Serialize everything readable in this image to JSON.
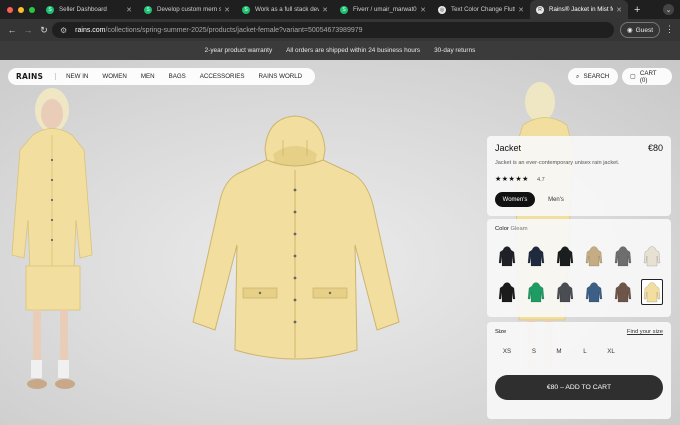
{
  "browser": {
    "tabs": [
      {
        "title": "Seller Dashboard",
        "color": "#1dbf73",
        "glyph": "S"
      },
      {
        "title": "Develop custom mern stack",
        "color": "#1dbf73",
        "glyph": "S"
      },
      {
        "title": "Work as a full stack developer",
        "color": "#1dbf73",
        "glyph": "S"
      },
      {
        "title": "Fiverr / umair_marwat0",
        "color": "#1dbf73",
        "glyph": "S"
      },
      {
        "title": "Text Color Change Flutter",
        "color": "#e8e8e8",
        "glyph": "◎"
      },
      {
        "title": "Rains® Jacket in Mist for Women",
        "color": "#e8e8e8",
        "glyph": "R"
      }
    ],
    "new_tab": "+",
    "url_host": "rains.com",
    "url_path": "/collections/spring-summer-2025/products/jacket-female?variant=50054673989979",
    "profile_label": "Guest",
    "traffic_colors": [
      "#ff5f57",
      "#febc2e",
      "#28c840"
    ]
  },
  "announcement": {
    "items": [
      "2-year product warranty",
      "All orders are shipped within 24 business hours",
      "30-day returns"
    ]
  },
  "nav": {
    "logo": "RAINS",
    "links": [
      "NEW IN",
      "WOMEN",
      "MEN",
      "BAGS",
      "ACCESSORIES",
      "RAINS WORLD"
    ],
    "search_label": "SEARCH",
    "cart_label": "CART (0)"
  },
  "product": {
    "title": "Jacket",
    "price": "€80",
    "description": "Jacket is an ever-contemporary unisex rain jacket.",
    "stars": "★★★★★",
    "rating": "4.7",
    "segments": [
      "Women's",
      "Men's"
    ],
    "color_label": "Color",
    "color_value": "Gleam",
    "swatches_row1": [
      "#1f2126",
      "#1f2a3f",
      "#1a1e1f",
      "#c6ac83",
      "#6e6e6e",
      "#e7e1d4"
    ],
    "swatches_row2": [
      "#1b1b1b",
      "#1d9d63",
      "#4a4d52",
      "#3b5f87",
      "#6d5549",
      "#f2df9f"
    ],
    "selected_swatch": 11,
    "size_label": "Size",
    "size_guide": "Find your size",
    "sizes": [
      "XS",
      "S",
      "M",
      "L",
      "XL"
    ],
    "add_to_cart": "€80 – ADD TO CART"
  },
  "colors": {
    "jacket": "#f2df9f",
    "jacket_shade": "#e0c97f",
    "accent_dark": "#2f2f2f"
  }
}
